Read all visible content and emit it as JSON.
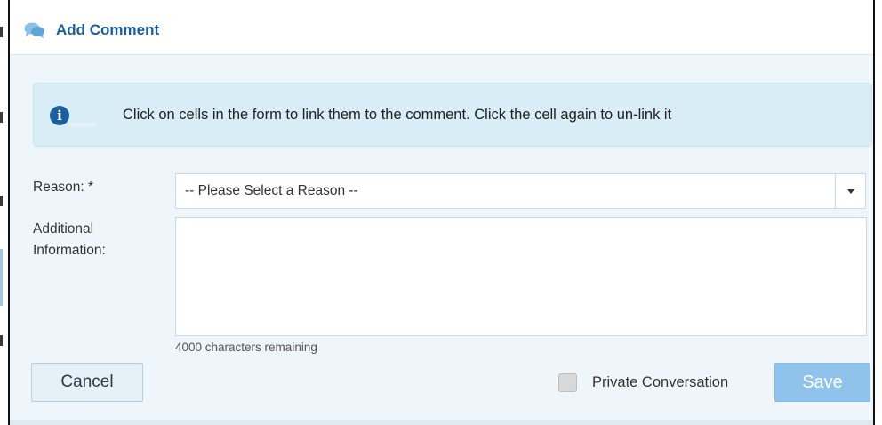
{
  "dialog": {
    "title": "Add Comment",
    "title_icon": "chat-bubbles-icon"
  },
  "info": {
    "icon": "info-circle-icon",
    "icon_glyph": "i",
    "message": "Click on cells in the form to link them to the comment. Click the cell again to un-link it"
  },
  "form": {
    "reason_label": "Reason: *",
    "reason_selected": "-- Please Select a Reason --",
    "additional_label_line1": "Additional",
    "additional_label_line2": "Information:",
    "additional_value": "",
    "chars_remaining": "4000 characters remaining"
  },
  "footer": {
    "cancel_label": "Cancel",
    "private_label": "Private Conversation",
    "private_checked": false,
    "save_label": "Save"
  },
  "colors": {
    "title": "#1a5d9c",
    "info_bg": "#d9edf7",
    "dialog_bg": "#eef6fb",
    "save_bg": "#8fc3eb",
    "cancel_bg": "#e5f0f7"
  }
}
